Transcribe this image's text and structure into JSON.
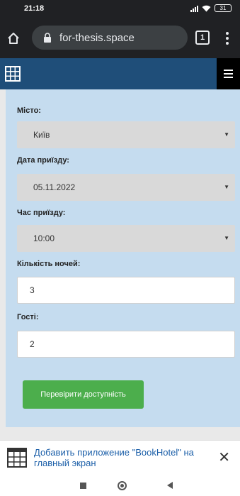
{
  "status_bar": {
    "time": "21:18",
    "battery": "31"
  },
  "browser": {
    "url": "for-thesis.space",
    "tab_count": "1"
  },
  "form": {
    "city_label": "Місто:",
    "city_value": "Київ",
    "arrival_date_label": "Дата приїзду:",
    "arrival_date_value": "05.11.2022",
    "arrival_time_label": "Час приїзду:",
    "arrival_time_value": "10:00",
    "nights_label": "Кількість ночей:",
    "nights_value": "3",
    "guests_label": "Гості:",
    "guests_value": "2",
    "submit_label": "Перевірити доступність"
  },
  "install_banner": {
    "text": "Добавить приложение \"BookHotel\" на главный экран",
    "close": "✕"
  },
  "colors": {
    "nav_bar": "#1f4e79",
    "form_background": "#c5dcef",
    "submit_button": "#4cae4c",
    "banner_link": "#1a5ea8"
  },
  "icons": [
    "home-icon",
    "lock-icon",
    "grid-icon",
    "hamburger-icon",
    "app-grid-icon",
    "close-icon"
  ]
}
